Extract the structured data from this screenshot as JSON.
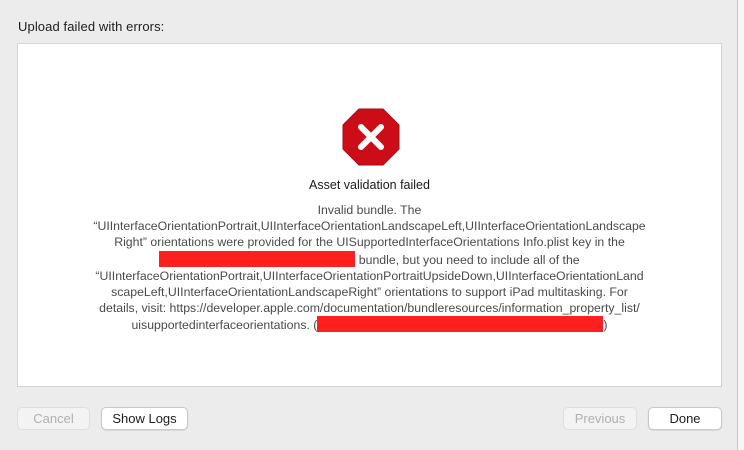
{
  "dialog": {
    "header": "Upload failed with errors:"
  },
  "message": {
    "icon": "error-octagon-icon",
    "icon_color": "#cc0d18",
    "title": "Asset validation failed",
    "line1": "Invalid bundle. The",
    "line2": "“UIInterfaceOrientationPortrait,UIInterfaceOrientationLandscapeLeft,UIInterfaceOrientationLandscape",
    "line3": "Right” orientations were provided for the UISupportedInterfaceOrientations Info.plist key in the",
    "line4_after": " bundle, but you need to include all of the",
    "line5": "“UIInterfaceOrientationPortrait,UIInterfaceOrientationPortraitUpsideDown,UIInterfaceOrientationLand",
    "line6": "scapeLeft,UIInterfaceOrientationLandscapeRight” orientations to support iPad multitasking. For",
    "line7": "details, visit: https://developer.apple.com/documentation/bundleresources/information_property_list/",
    "line8_before": "uisupportedinterfaceorientations. (",
    "line8_after": ")",
    "redaction_color": "#fe1f1f"
  },
  "buttons": {
    "cancel": "Cancel",
    "show_logs": "Show Logs",
    "previous": "Previous",
    "done": "Done"
  }
}
